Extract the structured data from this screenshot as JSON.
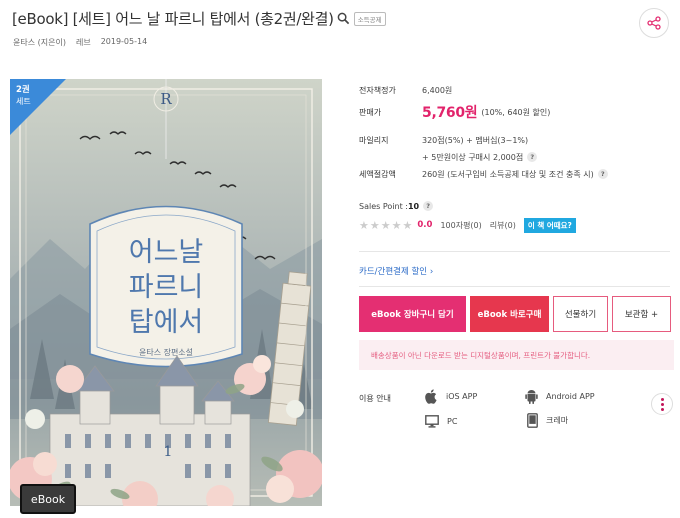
{
  "product": {
    "title": "[eBook] [세트] 어느 날 파르니 탑에서 (총2권/완결)",
    "deduction_badge": "소득공제",
    "author": "윤타스 (지은이)",
    "publisher": "레브",
    "date": "2019-05-14"
  },
  "cover": {
    "set_count": "2권",
    "set_label": "세트",
    "title_line1": "어느날",
    "title_line2": "파르니",
    "title_line3": "탑에서",
    "subtitle": "윤타스 장편소설",
    "volume": "1",
    "crest": "R",
    "format_tag": "eBook"
  },
  "pricing": {
    "ebook_price_label": "전자책정가",
    "ebook_price": "6,400원",
    "sale_label": "판매가",
    "sale_price": "5,760원",
    "sale_note": "(10%, 640원 할인)",
    "mileage_label": "마일리지",
    "mileage_value": "320점(5%) + 멤버십(3~1%)",
    "mileage_extra": "+ 5만원이상 구매시 2,000점",
    "tax_label": "세액절감액",
    "tax_value": "260원 (도서구입비 소득공제 대상 및 조건 충족 시)"
  },
  "sales": {
    "label": "Sales Point : ",
    "value": "10",
    "score": "0.0",
    "reviews_100": "100자평(0)",
    "reviews": "리뷰(0)",
    "eval_button": "이 책 어때요?",
    "star_count": 5
  },
  "card_discount": "카드/간편결제 할인 ›",
  "buttons": {
    "cart": "eBook 장바구니 담기",
    "buy": "eBook 바로구매",
    "gift": "선물하기",
    "keep": "보관함 +"
  },
  "notice": "배송상품이 아닌 다운로드 받는 디지털상품이며, 프린트가 불가합니다.",
  "usage": {
    "label": "이용 안내",
    "ios": "iOS APP",
    "android": "Android APP",
    "pc": "PC",
    "crema": "크레마"
  },
  "colors": {
    "accent": "#e42f72",
    "buy": "#e6374e",
    "link": "#2d6cc8",
    "eval": "#20a8e0",
    "ribbon": "#3b8ad9"
  },
  "icons": [
    "share-icon",
    "search-icon",
    "apple-icon",
    "android-icon",
    "monitor-icon",
    "ereader-icon",
    "more-vertical-icon",
    "star-icon",
    "help-icon"
  ]
}
